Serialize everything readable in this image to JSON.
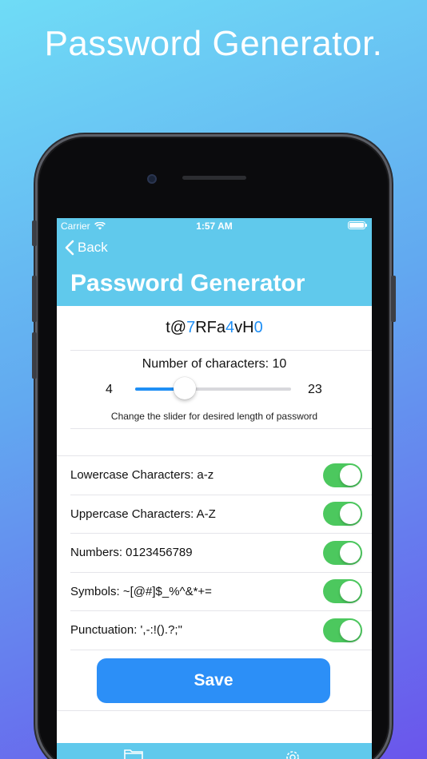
{
  "headline": "Password Generator.",
  "status": {
    "carrier": "Carrier",
    "time": "1:57 AM"
  },
  "nav": {
    "back_label": "Back",
    "title": "Password Generator"
  },
  "password": {
    "segments": [
      {
        "text": "t@",
        "numeric": false
      },
      {
        "text": "7",
        "numeric": true
      },
      {
        "text": "RFa",
        "numeric": false
      },
      {
        "text": "4",
        "numeric": true
      },
      {
        "text": "vH",
        "numeric": false
      },
      {
        "text": "0",
        "numeric": true
      }
    ]
  },
  "length": {
    "label": "Number of characters: 10",
    "min": "4",
    "max": "23",
    "value": 10,
    "hint": "Change the slider for desired length of password"
  },
  "options": [
    {
      "label": "Lowercase Characters: a-z",
      "enabled": true
    },
    {
      "label": "Uppercase Characters: A-Z",
      "enabled": true
    },
    {
      "label": "Numbers: 0123456789",
      "enabled": true
    },
    {
      "label": "Symbols: ~[@#]$_%^&*+=",
      "enabled": true
    },
    {
      "label": "Punctuation: ',-:!().?;\"",
      "enabled": true
    }
  ],
  "save_label": "Save",
  "colors": {
    "nav": "#60c9ec",
    "accent": "#1f8ff5",
    "toggle_on": "#4cc85e",
    "save": "#2c8ff7"
  },
  "tabbar": {
    "icons": [
      "folder-icon",
      "gear-icon"
    ]
  }
}
